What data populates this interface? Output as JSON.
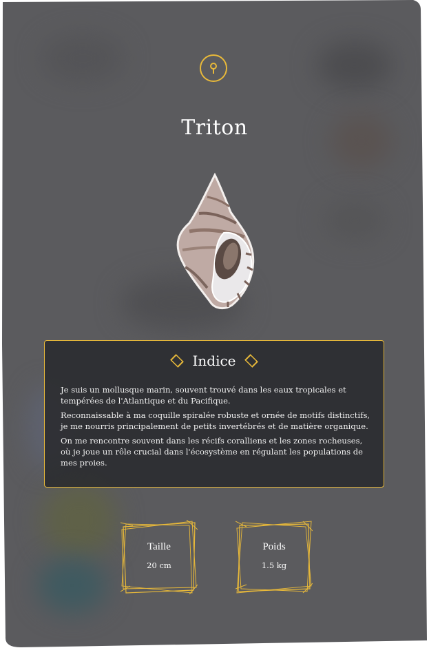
{
  "species": {
    "name": "Triton",
    "location_icon": "location-pin-icon"
  },
  "hint": {
    "title": "Indice",
    "paragraphs": [
      "Je suis un mollusque marin, souvent trouvé dans les eaux tropicales et tempérées de l'Atlantique et du Pacifique.",
      "Reconnaissable à ma coquille spiralée robuste et ornée de motifs distinctifs, je me nourris principalement de petits invertébrés et de matière organique.",
      "On me rencontre souvent dans les récifs coralliens et les zones rocheuses, où je joue un rôle crucial dans l'écosystème en régulant les populations de mes proies."
    ]
  },
  "stats": [
    {
      "label": "Taille",
      "value": "20 cm"
    },
    {
      "label": "Poids",
      "value": "1.5 kg"
    }
  ],
  "colors": {
    "accent": "#e8b93a",
    "card_bg": "#5b5b5e",
    "hint_bg": "#2b2c30",
    "text": "#ffffff"
  }
}
